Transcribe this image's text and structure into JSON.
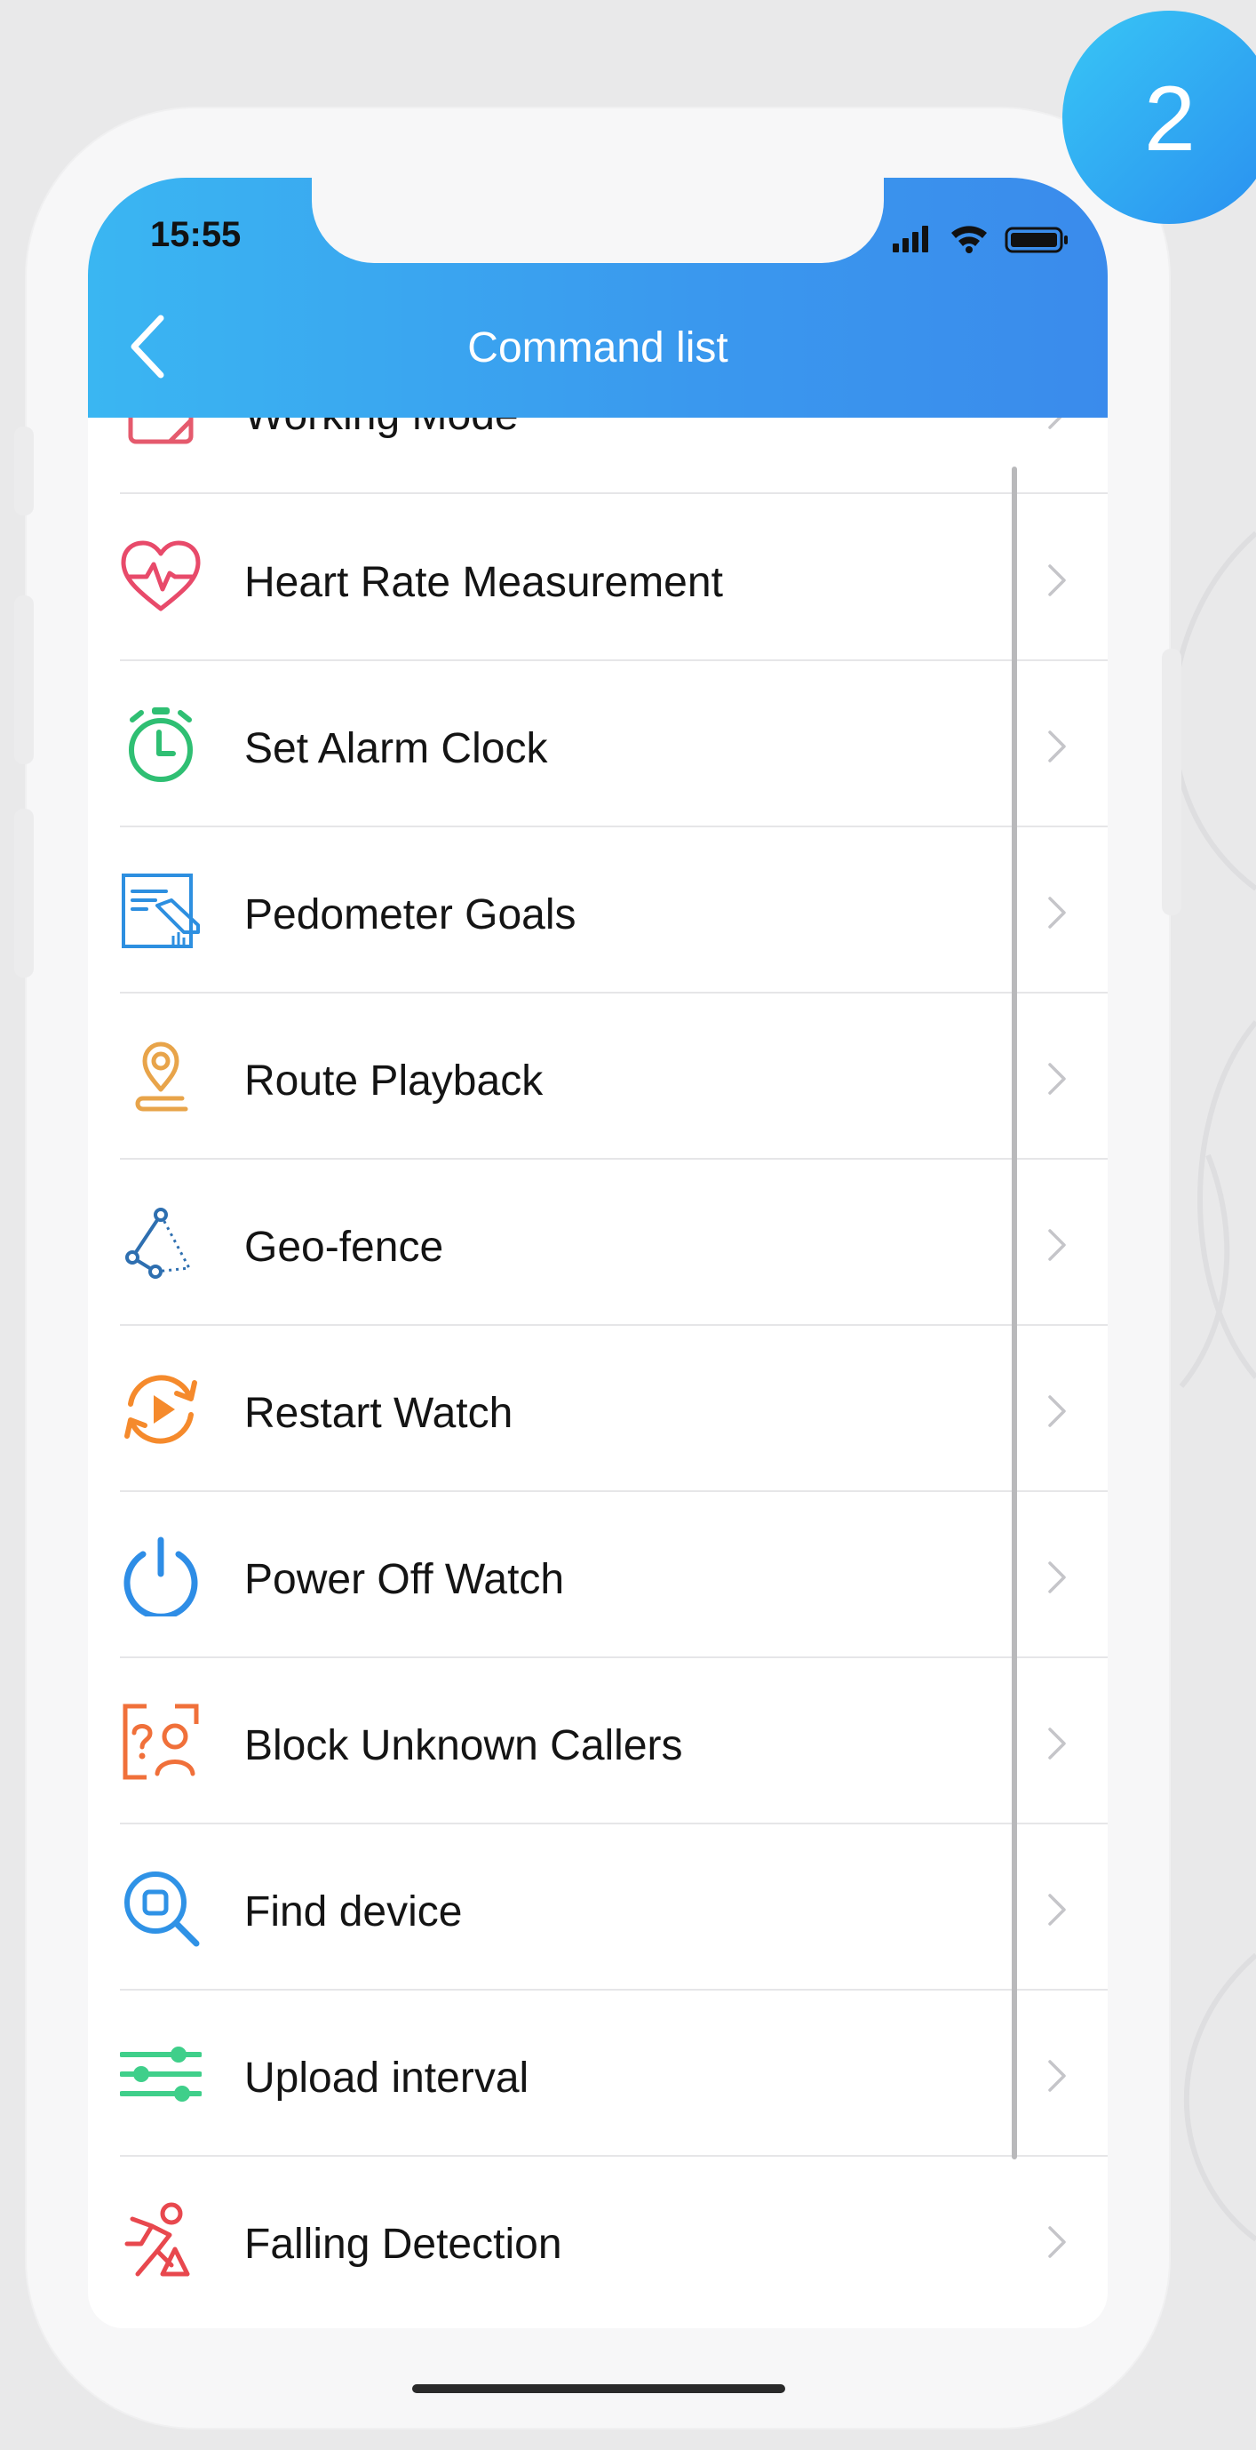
{
  "step_badge": "2",
  "status_bar": {
    "time": "15:55"
  },
  "header": {
    "title": "Command list"
  },
  "menu": [
    {
      "label": "Working Mode",
      "icon": "working-mode-icon",
      "color": "#e55a6d"
    },
    {
      "label": "Heart Rate Measurement",
      "icon": "heart-rate-icon",
      "color": "#e84a6a"
    },
    {
      "label": "Set Alarm Clock",
      "icon": "alarm-clock-icon",
      "color": "#2fbf73"
    },
    {
      "label": "Pedometer Goals",
      "icon": "pedometer-icon",
      "color": "#2d8fe0"
    },
    {
      "label": "Route Playback",
      "icon": "route-playback-icon",
      "color": "#e8a44a"
    },
    {
      "label": "Geo-fence",
      "icon": "geo-fence-icon",
      "color": "#2e6fb0"
    },
    {
      "label": "Restart Watch",
      "icon": "restart-icon",
      "color": "#f58a2c"
    },
    {
      "label": "Power Off Watch",
      "icon": "power-icon",
      "color": "#2e8de6"
    },
    {
      "label": "Block Unknown Callers",
      "icon": "block-callers-icon",
      "color": "#f0703a"
    },
    {
      "label": "Find device",
      "icon": "find-device-icon",
      "color": "#2f92e6"
    },
    {
      "label": "Upload interval",
      "icon": "upload-interval-icon",
      "color": "#3fcf8a"
    },
    {
      "label": "Falling Detection",
      "icon": "falling-detection-icon",
      "color": "#e8484e"
    }
  ]
}
